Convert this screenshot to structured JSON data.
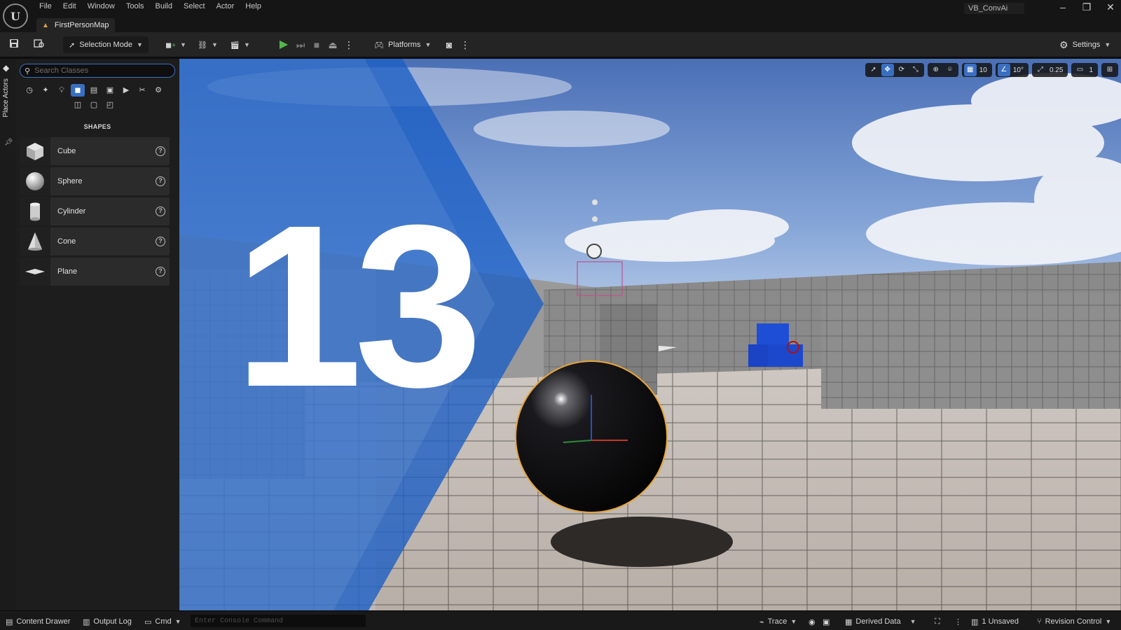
{
  "window": {
    "project_name": "VB_ConvAi",
    "minimize": "–",
    "restore": "❐",
    "close": "✕"
  },
  "menu": [
    "File",
    "Edit",
    "Window",
    "Tools",
    "Build",
    "Select",
    "Actor",
    "Help"
  ],
  "level_tab": {
    "label": "FirstPersonMap"
  },
  "toolbar": {
    "selection_mode": "Selection Mode",
    "platforms": "Platforms",
    "settings": "Settings"
  },
  "left_tab": {
    "label": "Place Actors"
  },
  "place_actors": {
    "search_placeholder": "Search Classes",
    "section_title": "SHAPES",
    "shapes": [
      {
        "label": "Cube",
        "icon": "cube-icon"
      },
      {
        "label": "Sphere",
        "icon": "sphere-icon"
      },
      {
        "label": "Cylinder",
        "icon": "cylinder-icon"
      },
      {
        "label": "Cone",
        "icon": "cone-icon"
      },
      {
        "label": "Plane",
        "icon": "plane-icon"
      }
    ]
  },
  "viewport": {
    "grid_snap": "10",
    "rotation_snap": "10°",
    "scale_snap": "0.25",
    "camera_speed": "1"
  },
  "overlay": {
    "episode_number": "13"
  },
  "statusbar": {
    "content_drawer": "Content Drawer",
    "output_log": "Output Log",
    "cmd": "Cmd",
    "console_placeholder": "Enter Console Command",
    "trace": "Trace",
    "derived_data": "Derived Data",
    "unsaved": "1 Unsaved",
    "revision_control": "Revision Control"
  },
  "colors": {
    "accent_blue": "#3a6fc0",
    "play_green": "#53b74b",
    "warning_orange": "#e3a13b",
    "overlay_blue": "#1d5fc4"
  }
}
